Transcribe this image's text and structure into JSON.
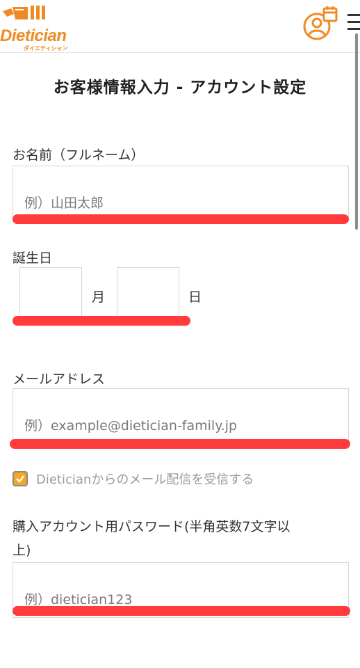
{
  "header": {
    "logo_text": "Dietician",
    "logo_sub": "ダイエティシャン",
    "account_icon": "user-calendar-icon",
    "menu_icon": "hamburger-menu-icon",
    "brand_color": "#f08a24"
  },
  "page_title": "お客様情報入力 - アカウント設定",
  "form": {
    "name": {
      "label": "お名前（フルネーム）",
      "placeholder": "例）山田太郎",
      "value": ""
    },
    "birthday": {
      "label": "誕生日",
      "month_unit": "月",
      "day_unit": "日",
      "month_value": "",
      "day_value": ""
    },
    "email": {
      "label": "メールアドレス",
      "placeholder": "例）example@dietician-family.jp",
      "value": ""
    },
    "newsletter": {
      "label": "Dieticianからのメール配信を受信する",
      "checked": true
    },
    "password": {
      "label": "購入アカウント用パスワード(半角英数7文字以上)",
      "label_line1": "購入アカウント用パスワード(半角英数7文字以",
      "label_line2": "上)",
      "placeholder": "例）dietician123",
      "value": ""
    }
  },
  "colors": {
    "highlight_red": "#ff3b3b",
    "checkbox_fill": "#f5a623"
  }
}
